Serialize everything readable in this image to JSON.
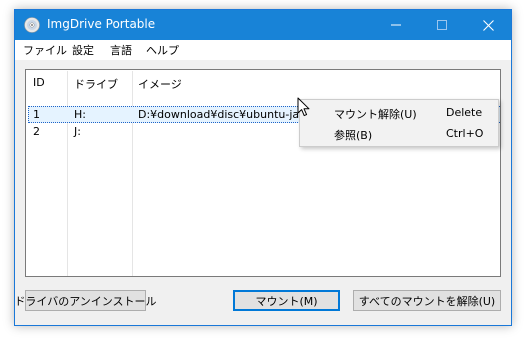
{
  "window": {
    "title": "ImgDrive Portable",
    "controls": {
      "minimize": "minimize-icon",
      "maximize": "maximize-icon",
      "close": "close-icon"
    }
  },
  "menu": [
    {
      "label": "ファイル"
    },
    {
      "label": "設定"
    },
    {
      "label": "言語"
    },
    {
      "label": "ヘルプ"
    }
  ],
  "table": {
    "columns": [
      "ID",
      "ドライブ",
      "イメージ"
    ],
    "rows": [
      {
        "id": "1",
        "drive": "H:",
        "image": "D:¥download¥disc¥ubuntu-ja-21.10",
        "selected": true
      },
      {
        "id": "2",
        "drive": "J:",
        "image": "",
        "selected": false
      }
    ]
  },
  "context_menu": {
    "items": [
      {
        "label": "マウント解除(U)",
        "shortcut": "Delete"
      },
      {
        "label": "参照(B)",
        "shortcut": "Ctrl+O"
      }
    ]
  },
  "buttons": {
    "uninstall": "ドライバのアンインストール",
    "mount": "マウント(M)",
    "unmount_all": "すべてのマウントを解除(U)"
  },
  "colors": {
    "titlebar": "#1883d7",
    "selection": "#e5f3ff",
    "accent": "#0078d7"
  }
}
